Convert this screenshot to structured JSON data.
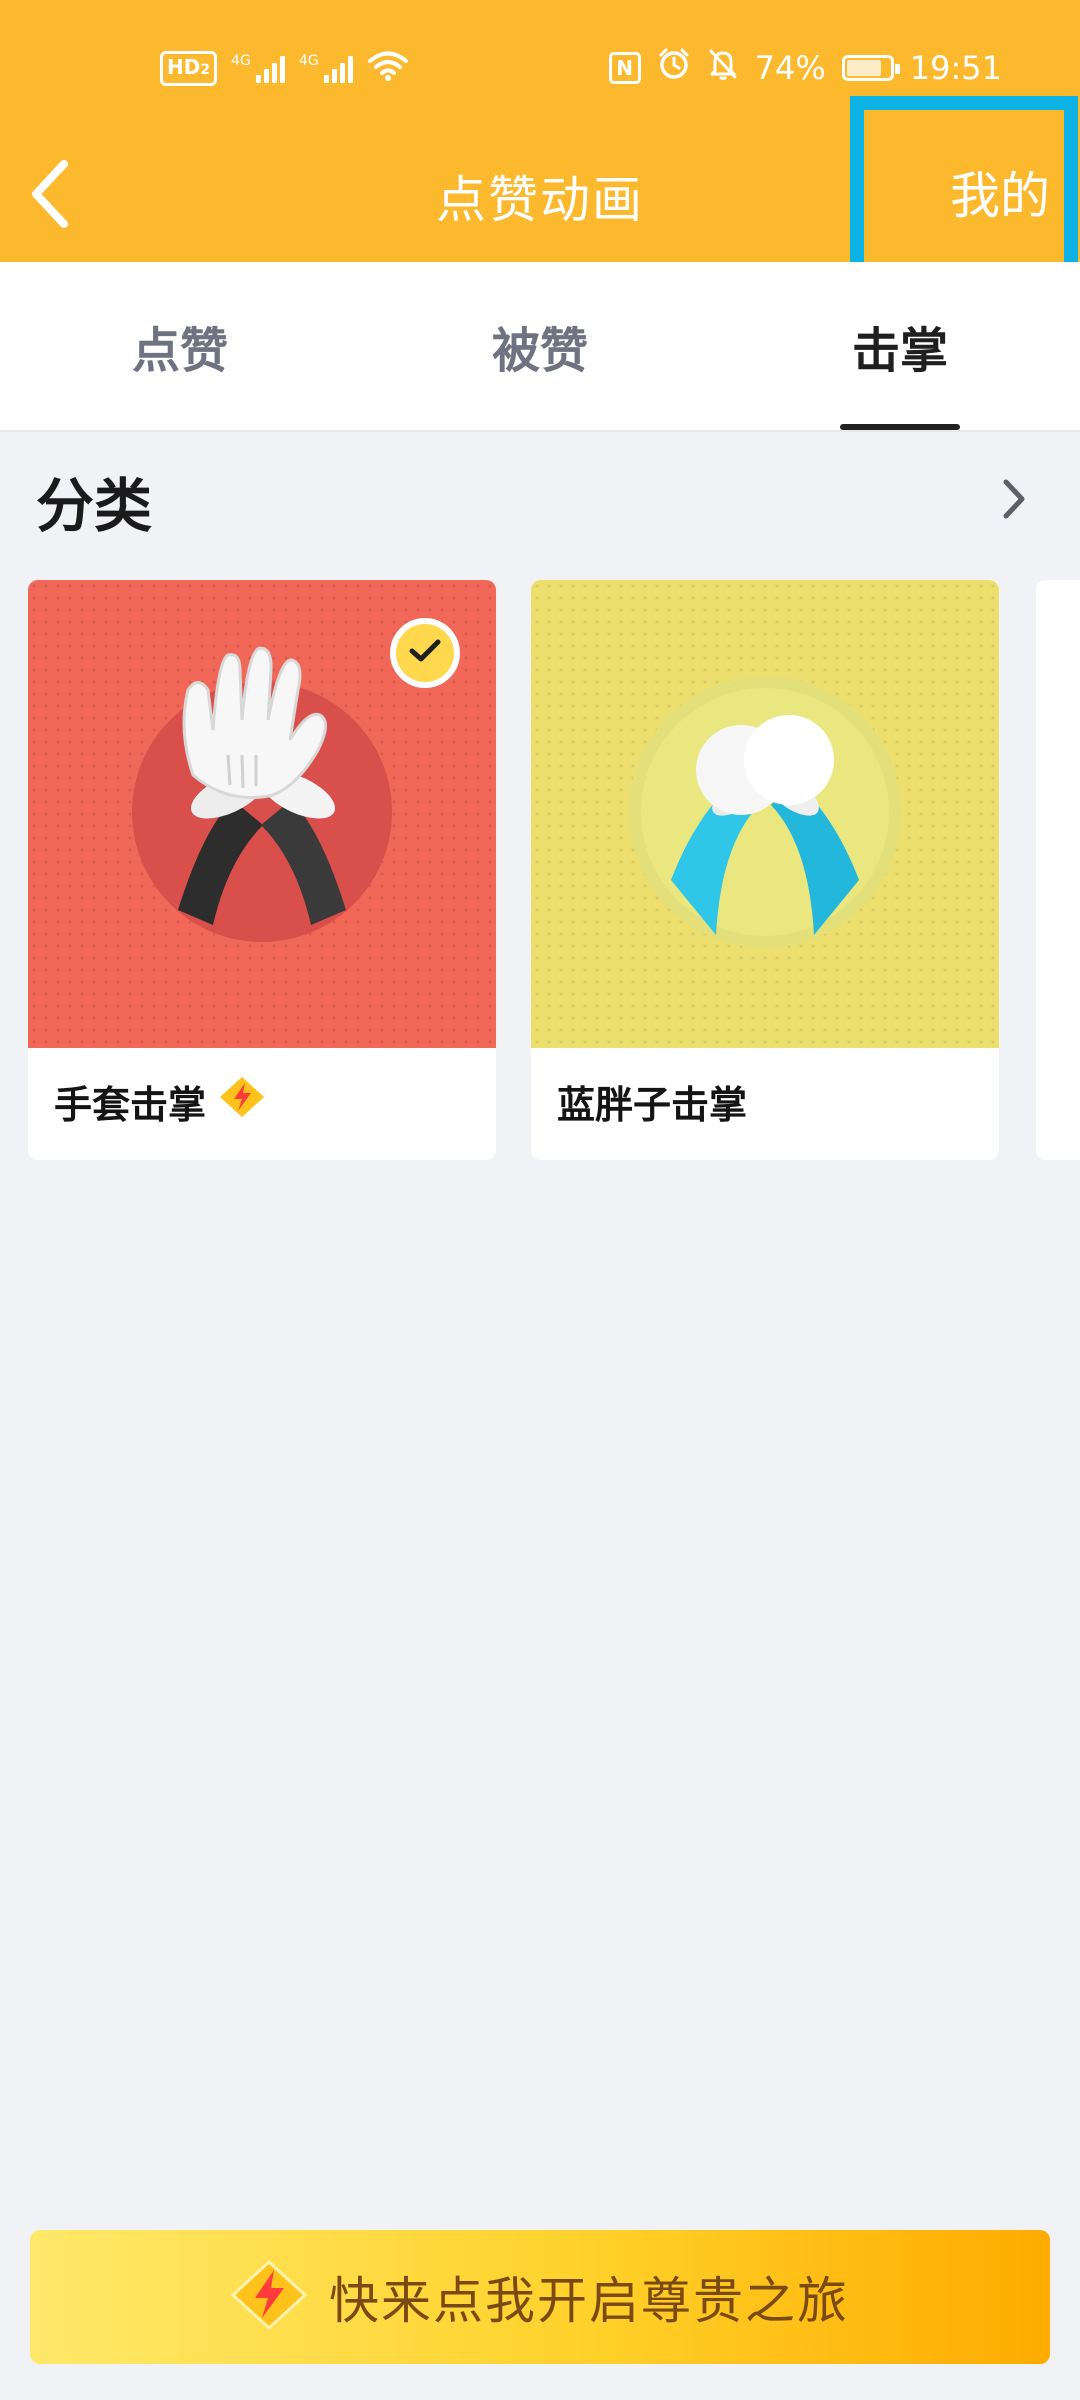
{
  "status_bar": {
    "hd_label": "HD",
    "sim_index": "2",
    "network_1": "4G",
    "network_2": "4G",
    "nfc_label": "N",
    "battery_percent": "74%",
    "time": "19:51"
  },
  "nav": {
    "title": "点赞动画",
    "right_action": "我的"
  },
  "tabs": [
    {
      "label": "点赞",
      "active": false
    },
    {
      "label": "被赞",
      "active": false
    },
    {
      "label": "击掌",
      "active": true
    }
  ],
  "section": {
    "title": "分类"
  },
  "cards": [
    {
      "name": "手套击掌",
      "selected": true,
      "badge": "vip-lightning-icon",
      "bg_color": "#f26858"
    },
    {
      "name": "蓝胖子击掌",
      "selected": false,
      "bg_color": "#ecdf6d"
    }
  ],
  "banner": {
    "text": "快来点我开启尊贵之旅"
  },
  "colors": {
    "header": "#fdb92e",
    "highlight": "#0bb2e3",
    "page_bg": "#f1f2f6"
  }
}
